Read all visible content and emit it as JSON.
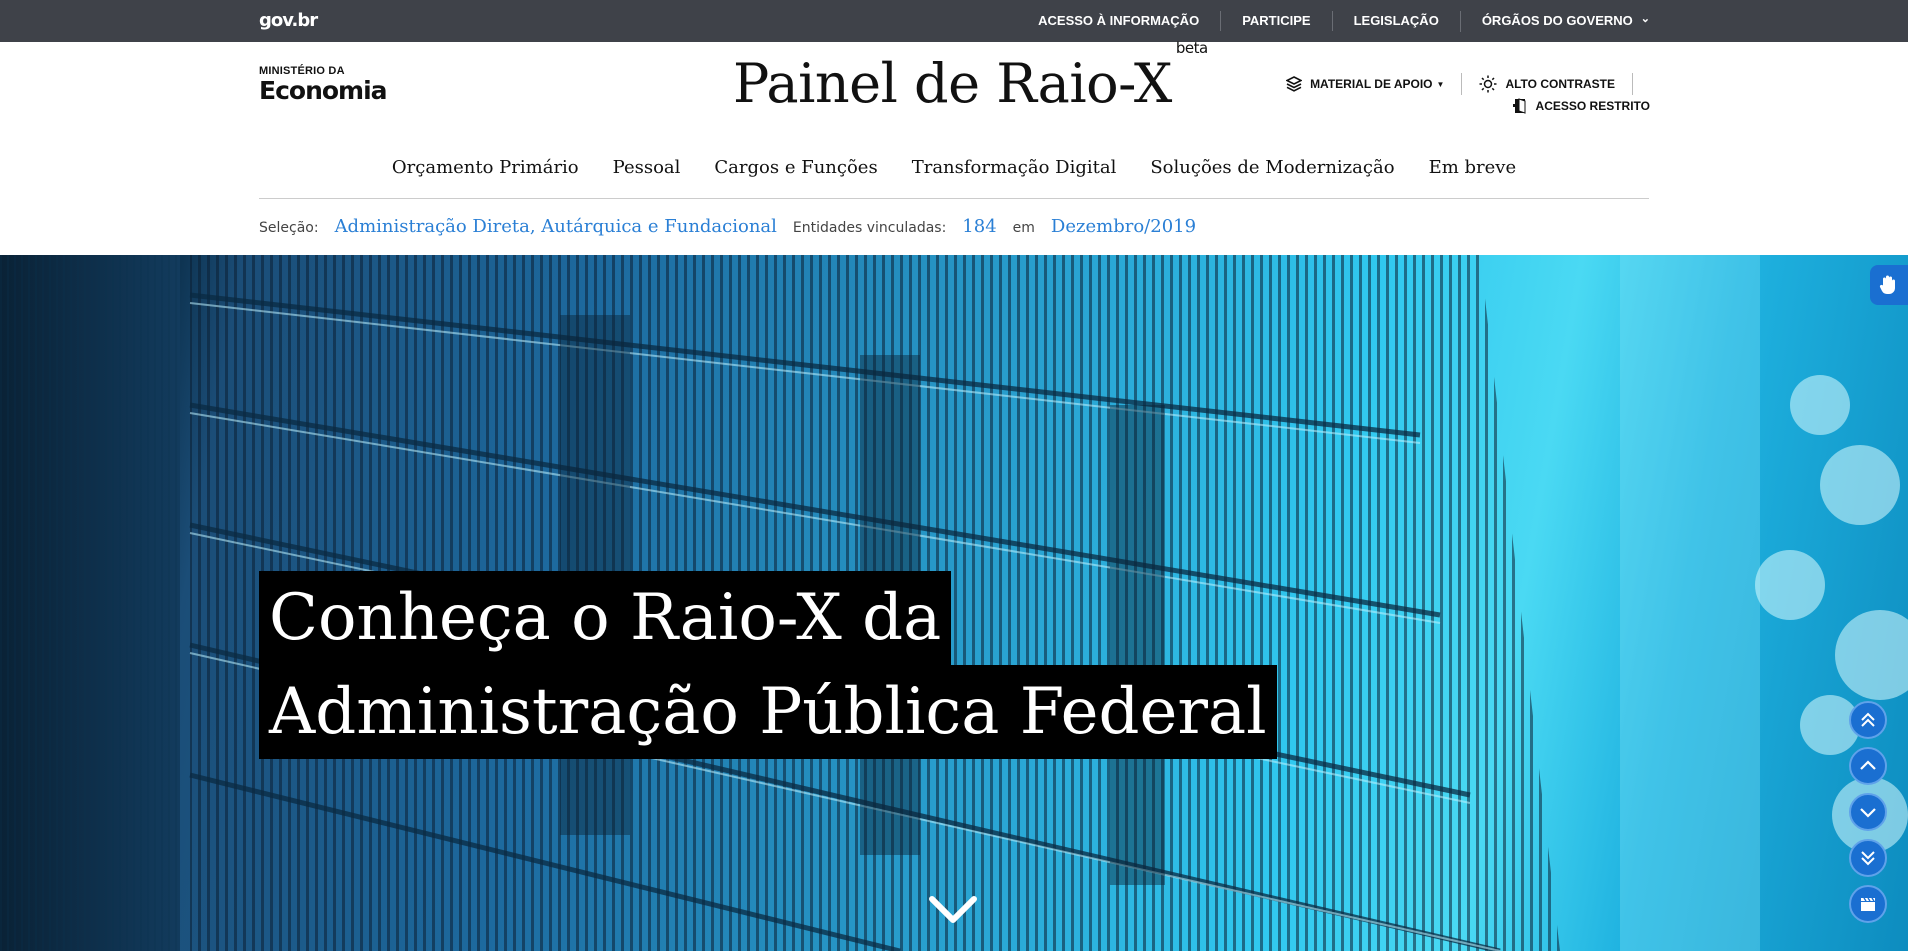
{
  "govbar": {
    "logo": "gov.br",
    "links": [
      {
        "label": "ACESSO À INFORMAÇÃO"
      },
      {
        "label": "PARTICIPE"
      },
      {
        "label": "LEGISLAÇÃO"
      },
      {
        "label": "ÓRGÃOS DO GOVERNO"
      }
    ]
  },
  "header": {
    "ministry_small": "MINISTÉRIO DA",
    "ministry_big": "Economia",
    "title": "Painel de Raio-X",
    "title_badge": "beta",
    "tools": {
      "material": "MATERIAL DE APOIO",
      "contrast": "ALTO CONTRASTE",
      "restricted": "ACESSO RESTRITO"
    }
  },
  "nav": {
    "items": [
      {
        "label": "Orçamento Primário"
      },
      {
        "label": "Pessoal"
      },
      {
        "label": "Cargos e Funções"
      },
      {
        "label": "Transformação Digital"
      },
      {
        "label": "Soluções de Modernização"
      },
      {
        "label": "Em breve"
      }
    ]
  },
  "selection": {
    "label": "Seleção:",
    "value": "Administração Direta, Autárquica e Fundacional",
    "entities_label": "Entidades vinculadas:",
    "entities_count": "184",
    "in_label": "em",
    "period": "Dezembro/2019"
  },
  "hero": {
    "line1": "Conheça o Raio-X da",
    "line2": "Administração Pública Federal"
  },
  "icons": {
    "scroll_down": "chevron-down-icon",
    "vlibras": "hand-sign-icon",
    "float_buttons": [
      "double-chevron-up-icon",
      "chevron-up-icon",
      "chevron-down-icon",
      "double-chevron-down-icon",
      "clapperboard-icon"
    ]
  },
  "colors": {
    "govbar_bg": "#3f4249",
    "accent_blue": "#2a7fd5",
    "float_blue": "#1a6fd1"
  }
}
